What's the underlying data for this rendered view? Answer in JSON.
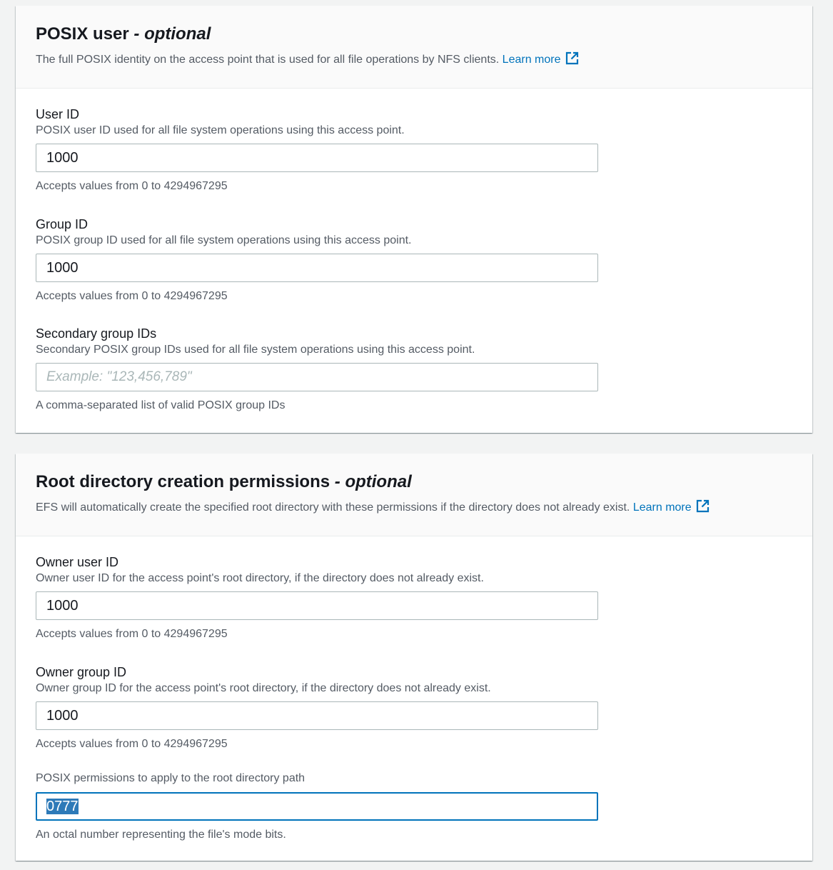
{
  "posix_section": {
    "title": "POSIX user",
    "title_optional": "- optional",
    "description": "The full POSIX identity on the access point that is used for all file operations by NFS clients.",
    "learn_more": "Learn more",
    "user_id": {
      "label": "User ID",
      "description": "POSIX user ID used for all file system operations using this access point.",
      "value": "1000",
      "hint": "Accepts values from 0 to 4294967295"
    },
    "group_id": {
      "label": "Group ID",
      "description": "POSIX group ID used for all file system operations using this access point.",
      "value": "1000",
      "hint": "Accepts values from 0 to 4294967295"
    },
    "secondary_group_ids": {
      "label": "Secondary group IDs",
      "description": "Secondary POSIX group IDs used for all file system operations using this access point.",
      "placeholder": "Example: \"123,456,789\"",
      "hint": "A comma-separated list of valid POSIX group IDs"
    }
  },
  "root_section": {
    "title": "Root directory creation permissions",
    "title_optional": "- optional",
    "description": "EFS will automatically create the specified root directory with these permissions if the directory does not already exist.",
    "learn_more": "Learn more",
    "owner_user_id": {
      "label": "Owner user ID",
      "description": "Owner user ID for the access point's root directory, if the directory does not already exist.",
      "value": "1000",
      "hint": "Accepts values from 0 to 4294967295"
    },
    "owner_group_id": {
      "label": "Owner group ID",
      "description": "Owner group ID for the access point's root directory, if the directory does not already exist.",
      "value": "1000",
      "hint": "Accepts values from 0 to 4294967295"
    },
    "permissions": {
      "label": "POSIX permissions to apply to the root directory path",
      "value": "0777",
      "hint": "An octal number representing the file's mode bits."
    }
  },
  "colors": {
    "link": "#0073bb",
    "focus_border": "#0073bb",
    "selection": "#2e7ab8",
    "page_background": "#f2f3f3"
  },
  "icons": {
    "learn_more": "external-link-icon"
  }
}
